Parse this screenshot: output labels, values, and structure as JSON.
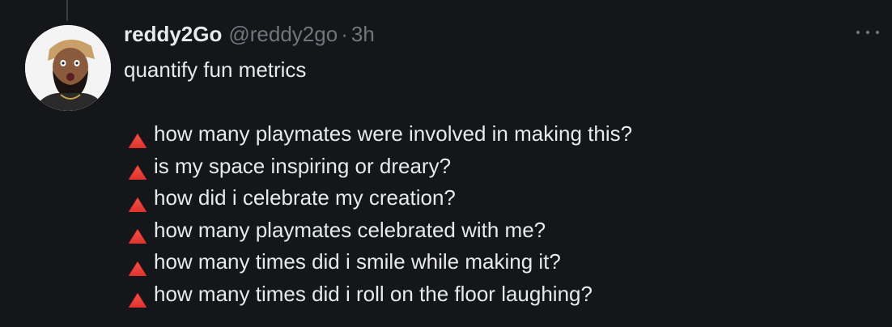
{
  "tweet": {
    "display_name": "reddy2Go",
    "handle": "@reddy2go",
    "separator": "·",
    "time": "3h",
    "intro": "quantify fun metrics",
    "bullet_icon": "red-triangle-up-icon",
    "bullet_color": "#e0322c",
    "bullets": [
      "how many playmates were involved in making this?",
      "is my space inspiring or dreary?",
      "how did i celebrate my creation?",
      "how many playmates celebrated with me?",
      "how many times did i smile while making it?",
      "how many times did i roll on the floor laughing?"
    ]
  },
  "colors": {
    "background": "#15161a",
    "text": "#e7e9ea",
    "muted": "#71767b"
  }
}
